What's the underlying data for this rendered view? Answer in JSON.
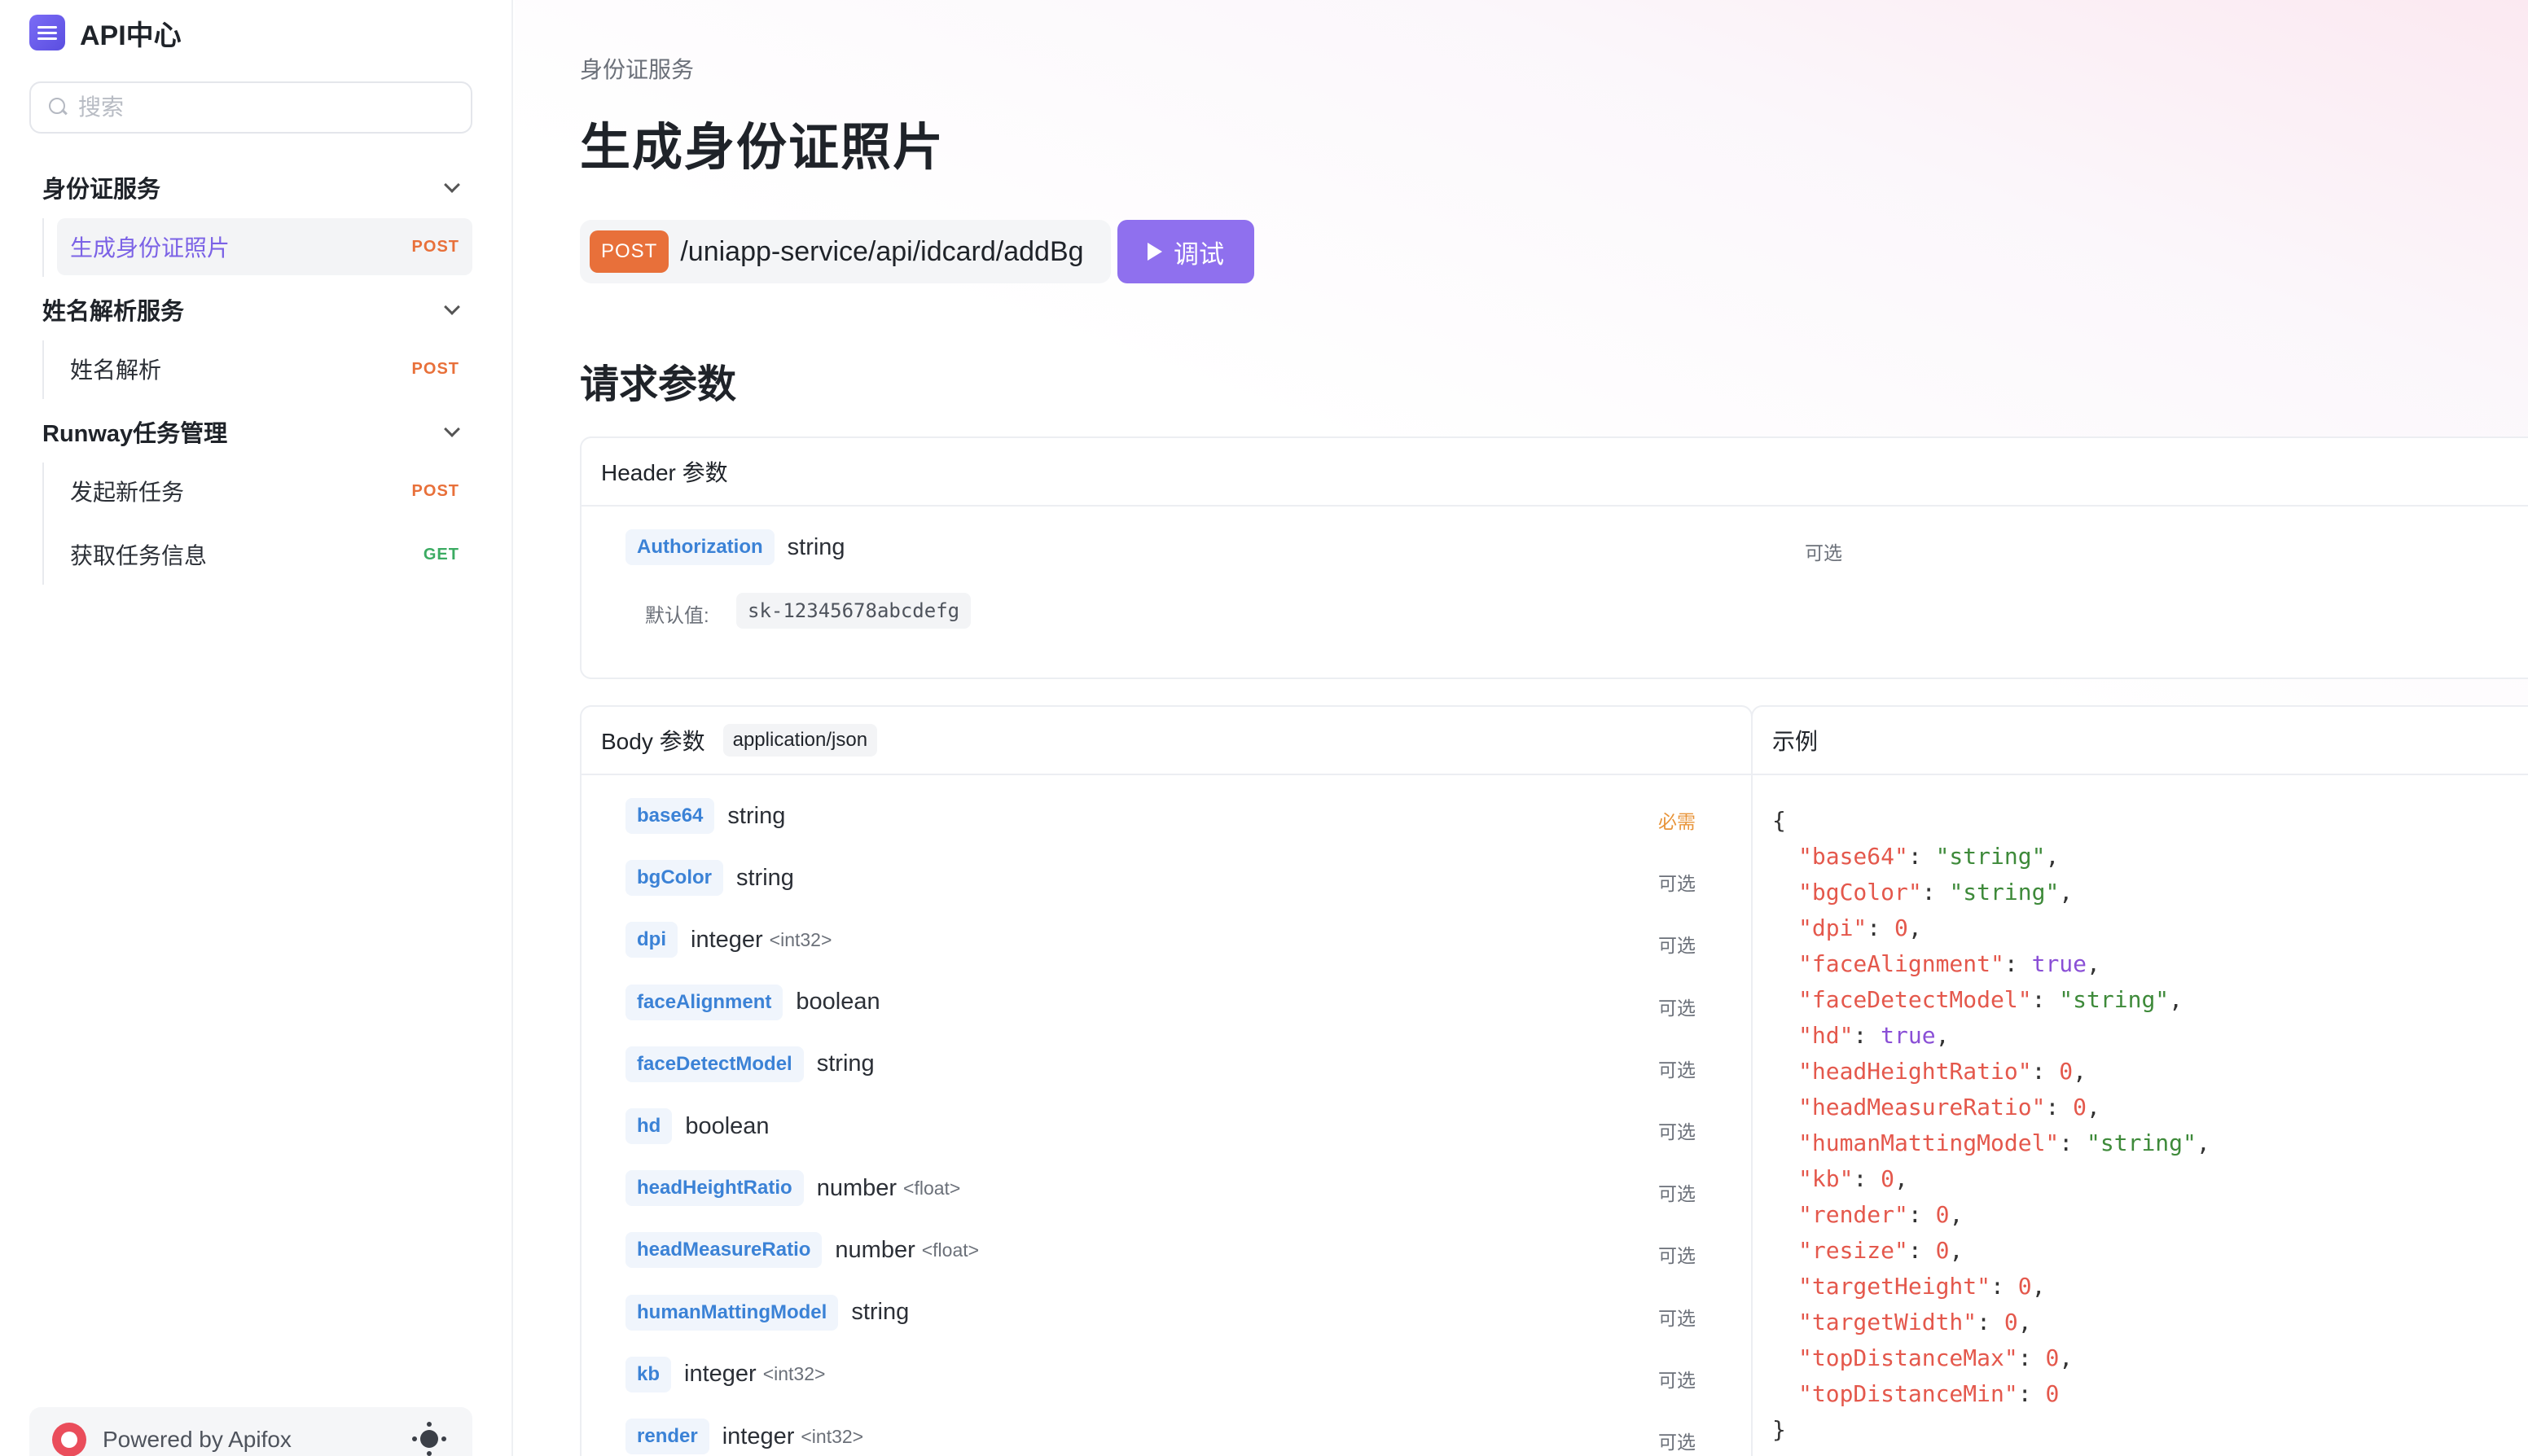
{
  "brand": {
    "name": "API中心"
  },
  "search": {
    "placeholder": "搜索"
  },
  "sidebar": {
    "groups": [
      {
        "title": "身份证服务",
        "items": [
          {
            "label": "生成身份证照片",
            "method": "POST"
          }
        ]
      },
      {
        "title": "姓名解析服务",
        "items": [
          {
            "label": "姓名解析",
            "method": "POST"
          }
        ]
      },
      {
        "title": "Runway任务管理",
        "items": [
          {
            "label": "发起新任务",
            "method": "POST"
          },
          {
            "label": "获取任务信息",
            "method": "GET"
          }
        ]
      }
    ],
    "powered_by": "Powered by Apifox"
  },
  "main": {
    "breadcrumb": "身份证服务",
    "title": "生成身份证照片",
    "method": "POST",
    "path": "/uniapp-service/api/idcard/addBg",
    "try_label": "调试",
    "request_params_title": "请求参数"
  },
  "header_params": {
    "title": "Header 参数",
    "items": [
      {
        "name": "Authorization",
        "type": "string",
        "status": "可选",
        "default_label": "默认值:",
        "default_value": "sk-12345678abcdefg"
      }
    ]
  },
  "body_params": {
    "title": "Body 参数",
    "content_type": "application/json",
    "items": [
      {
        "name": "base64",
        "type": "string",
        "format": "",
        "status": "必需"
      },
      {
        "name": "bgColor",
        "type": "string",
        "format": "",
        "status": "可选"
      },
      {
        "name": "dpi",
        "type": "integer",
        "format": "<int32>",
        "status": "可选"
      },
      {
        "name": "faceAlignment",
        "type": "boolean",
        "format": "",
        "status": "可选"
      },
      {
        "name": "faceDetectModel",
        "type": "string",
        "format": "",
        "status": "可选"
      },
      {
        "name": "hd",
        "type": "boolean",
        "format": "",
        "status": "可选"
      },
      {
        "name": "headHeightRatio",
        "type": "number",
        "format": "<float>",
        "status": "可选"
      },
      {
        "name": "headMeasureRatio",
        "type": "number",
        "format": "<float>",
        "status": "可选"
      },
      {
        "name": "humanMattingModel",
        "type": "string",
        "format": "",
        "status": "可选"
      },
      {
        "name": "kb",
        "type": "integer",
        "format": "<int32>",
        "status": "可选"
      },
      {
        "name": "render",
        "type": "integer",
        "format": "<int32>",
        "status": "可选"
      }
    ]
  },
  "example": {
    "title": "示例",
    "open_brace": "{",
    "close_brace": "}",
    "lines": [
      {
        "key": "\"base64\"",
        "value": "\"string\"",
        "kind": "s",
        "comma": ","
      },
      {
        "key": "\"bgColor\"",
        "value": "\"string\"",
        "kind": "s",
        "comma": ","
      },
      {
        "key": "\"dpi\"",
        "value": "0",
        "kind": "n",
        "comma": ","
      },
      {
        "key": "\"faceAlignment\"",
        "value": "true",
        "kind": "b",
        "comma": ","
      },
      {
        "key": "\"faceDetectModel\"",
        "value": "\"string\"",
        "kind": "s",
        "comma": ","
      },
      {
        "key": "\"hd\"",
        "value": "true",
        "kind": "b",
        "comma": ","
      },
      {
        "key": "\"headHeightRatio\"",
        "value": "0",
        "kind": "n",
        "comma": ","
      },
      {
        "key": "\"headMeasureRatio\"",
        "value": "0",
        "kind": "n",
        "comma": ","
      },
      {
        "key": "\"humanMattingModel\"",
        "value": "\"string\"",
        "kind": "s",
        "comma": ","
      },
      {
        "key": "\"kb\"",
        "value": "0",
        "kind": "n",
        "comma": ","
      },
      {
        "key": "\"render\"",
        "value": "0",
        "kind": "n",
        "comma": ","
      },
      {
        "key": "\"resize\"",
        "value": "0",
        "kind": "n",
        "comma": ","
      },
      {
        "key": "\"targetHeight\"",
        "value": "0",
        "kind": "n",
        "comma": ","
      },
      {
        "key": "\"targetWidth\"",
        "value": "0",
        "kind": "n",
        "comma": ","
      },
      {
        "key": "\"topDistanceMax\"",
        "value": "0",
        "kind": "n",
        "comma": ","
      },
      {
        "key": "\"topDistanceMin\"",
        "value": "0",
        "kind": "n",
        "comma": ""
      }
    ]
  }
}
